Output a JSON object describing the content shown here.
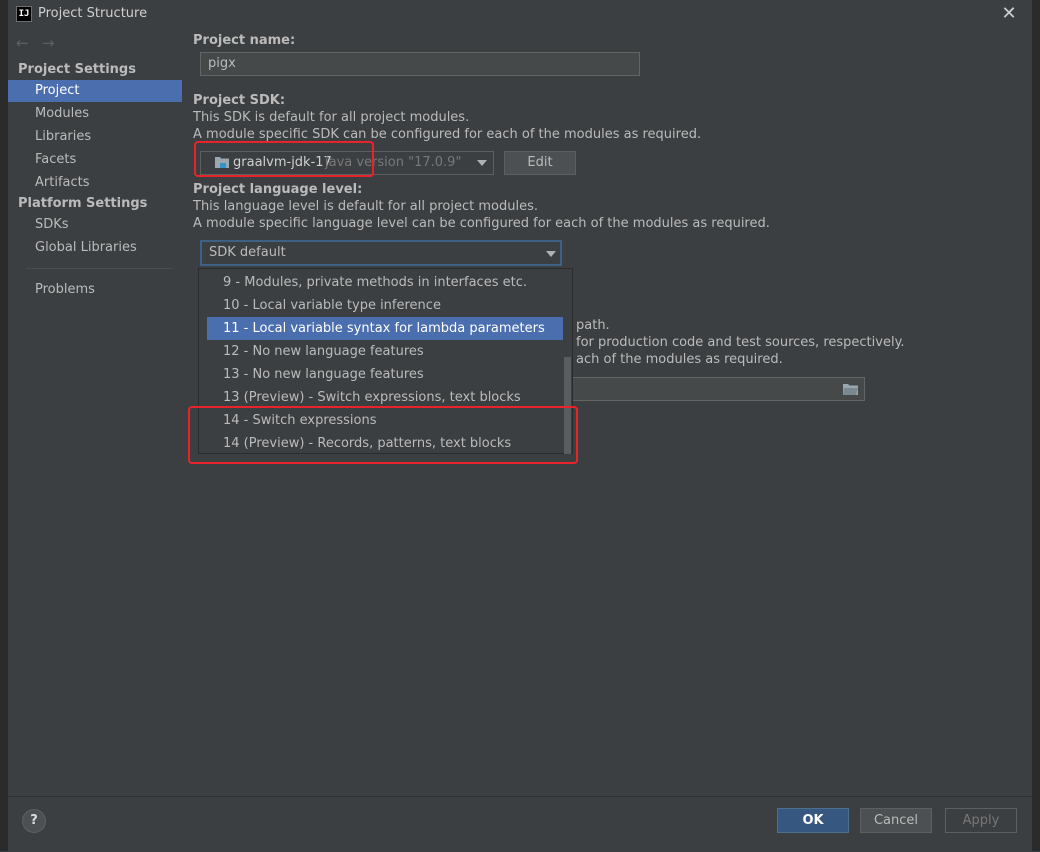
{
  "window": {
    "title": "Project Structure",
    "app_icon_text": "IJ"
  },
  "sidebar": {
    "sections": [
      {
        "label": "Project Settings",
        "items": [
          "Project",
          "Modules",
          "Libraries",
          "Facets",
          "Artifacts"
        ]
      },
      {
        "label": "Platform Settings",
        "items": [
          "SDKs",
          "Global Libraries"
        ]
      }
    ],
    "extra_items": [
      "Problems"
    ],
    "selected": "Project"
  },
  "project_name": {
    "label": "Project name:",
    "value": "pigx"
  },
  "project_sdk": {
    "label": "Project SDK:",
    "desc1": "This SDK is default for all project modules.",
    "desc2": "A module specific SDK can be configured for each of the modules as required.",
    "sdk_name": "graalvm-jdk-17",
    "sdk_version": "java version \"17.0.9\"",
    "edit_label": "Edit"
  },
  "language_level": {
    "label": "Project language level:",
    "desc1": "This language level is default for all project modules.",
    "desc2": "A module specific language level can be configured for each of the modules as required.",
    "value": "SDK default",
    "options": [
      "9 - Modules, private methods in interfaces etc.",
      "10 - Local variable type inference",
      "11 - Local variable syntax for lambda parameters",
      "12 - No new language features",
      "13 - No new language features",
      "13 (Preview) - Switch expressions, text blocks",
      "14 - Switch expressions",
      "14 (Preview) - Records, patterns, text blocks"
    ],
    "highlighted_option": "11 - Local variable syntax for lambda parameters"
  },
  "compiler_output_partial": {
    "path_text_fragment": "path.",
    "line2_fragment": "for production code and test sources, respectively.",
    "line3_fragment": "ach of the modules as required."
  },
  "buttons": {
    "ok": "OK",
    "cancel": "Cancel",
    "apply": "Apply",
    "help": "?"
  },
  "colors": {
    "accent": "#4b6eaf",
    "highlight_box": "#e8242a",
    "background": "#3c3f41"
  }
}
